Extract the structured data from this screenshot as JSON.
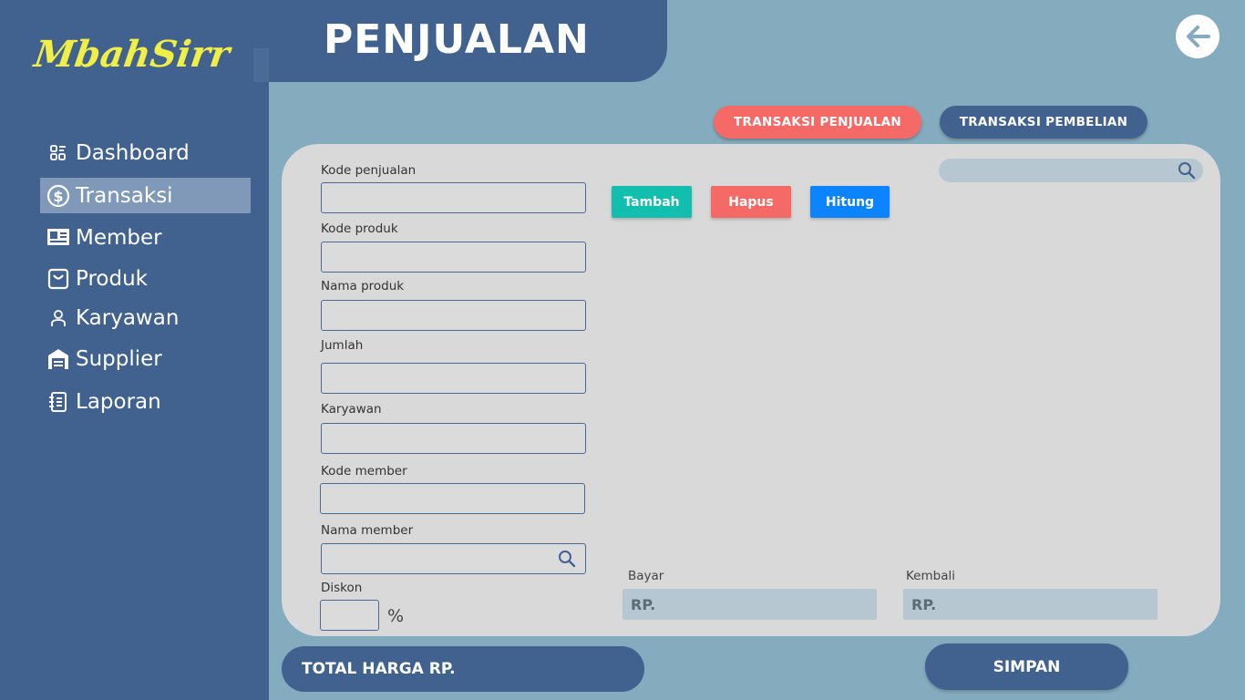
{
  "app": {
    "logo": "MbahSirr",
    "title": "PENJUALAN"
  },
  "sidebar": {
    "items": [
      {
        "label": "Dashboard",
        "icon": "dashboard-icon"
      },
      {
        "label": "Transaksi",
        "icon": "dollar-icon",
        "active": true
      },
      {
        "label": "Member",
        "icon": "id-card-icon"
      },
      {
        "label": "Produk",
        "icon": "bag-icon"
      },
      {
        "label": "Karyawan",
        "icon": "person-icon"
      },
      {
        "label": "Supplier",
        "icon": "warehouse-icon"
      },
      {
        "label": "Laporan",
        "icon": "notebook-icon"
      }
    ]
  },
  "tabs": {
    "penjualan": "TRANSAKSI PENJUALAN",
    "pembelian": "TRANSAKSI PEMBELIAN"
  },
  "form": {
    "kode_penjualan": {
      "label": "Kode penjualan",
      "value": ""
    },
    "kode_produk": {
      "label": "Kode produk",
      "value": ""
    },
    "nama_produk": {
      "label": "Nama produk",
      "value": ""
    },
    "jumlah": {
      "label": "Jumlah",
      "value": ""
    },
    "karyawan": {
      "label": "Karyawan",
      "value": ""
    },
    "kode_member": {
      "label": "Kode member",
      "value": ""
    },
    "nama_member": {
      "label": "Nama member",
      "value": ""
    },
    "diskon": {
      "label": "Diskon",
      "value": "",
      "unit": "%"
    }
  },
  "actions": {
    "tambah": "Tambah",
    "hapus": "Hapus",
    "hitung": "Hitung"
  },
  "payment": {
    "bayar_label": "Bayar",
    "bayar_value": "RP.",
    "kembali_label": "Kembali",
    "kembali_value": "RP."
  },
  "footer": {
    "total": "TOTAL HARGA RP.",
    "save": "SIMPAN"
  },
  "colors": {
    "sidebar": "#41628f",
    "background": "#84abbe",
    "panel": "#d9d9d9",
    "logo": "#f1ee45",
    "tambah": "#12bfae",
    "hapus": "#f56a66",
    "hitung": "#0d84ff"
  }
}
